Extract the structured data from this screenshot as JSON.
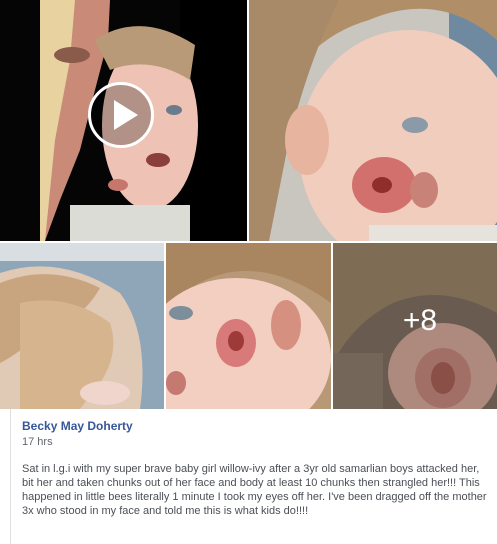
{
  "media": {
    "video_play_icon": "play-icon",
    "more_photos_label": "+8"
  },
  "post": {
    "author": "Becky May Doherty",
    "time": "17 hrs",
    "text": "Sat in l.g.i with my super brave baby girl willow-ivy after a 3yr old samarlian boys attacked her, bit her and taken chunks out of her face and body at least 10 chunks then strangled her!!! This happened in little bees literally 1 minute I took my eyes off her. I've been dragged off the mother 3x who stood in my face and told me this is what kids do!!!!"
  },
  "colors": {
    "author_link": "#365899",
    "meta_text": "#616770",
    "body_text": "#4b4f56",
    "divider": "#dddfe2"
  }
}
